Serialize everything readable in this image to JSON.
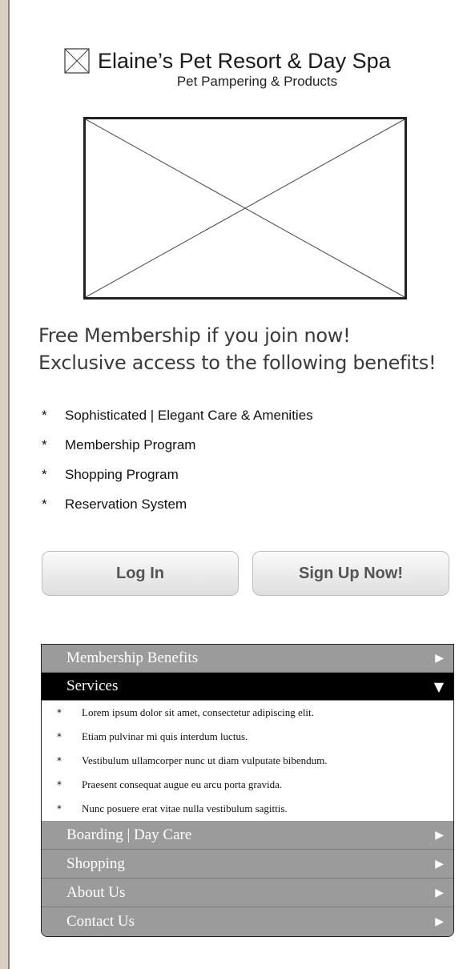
{
  "header": {
    "logo_icon": "image-placeholder-icon",
    "title": "Elaine’s Pet Resort & Day Spa",
    "tagline": "Pet Pampering & Products"
  },
  "hero": {
    "icon": "image-placeholder-icon"
  },
  "promo": {
    "line1": "Free Membership if you join now!",
    "line2": "Exclusive access to the following benefits!"
  },
  "benefits": [
    "Sophisticated | Elegant Care & Amenities",
    "Membership Program",
    "Shopping Program",
    "Reservation System"
  ],
  "bullet": "*",
  "buttons": {
    "login": "Log In",
    "signup": "Sign Up Now!"
  },
  "accordion": {
    "sections": [
      {
        "label": "Membership Benefits",
        "expanded": false
      },
      {
        "label": "Services",
        "expanded": true,
        "items": [
          "Lorem ipsum dolor sit amet, consectetur adipiscing elit.",
          "Etiam pulvinar mi quis interdum luctus.",
          "Vestibulum ullamcorper nunc ut diam vulputate bibendum.",
          "Praesent consequat augue eu arcu porta gravida.",
          "Nunc posuere erat vitae nulla vestibulum sagittis."
        ]
      },
      {
        "label": "Boarding | Day Care",
        "expanded": false
      },
      {
        "label": "Shopping",
        "expanded": false
      },
      {
        "label": "About Us",
        "expanded": false
      },
      {
        "label": "Contact Us",
        "expanded": false
      }
    ],
    "arrow_collapsed": "▶",
    "arrow_expanded": "▼"
  },
  "colors": {
    "accordion_header": "#9b9b9b",
    "accordion_active": "#000000",
    "page_border": "#d7d0c3"
  }
}
